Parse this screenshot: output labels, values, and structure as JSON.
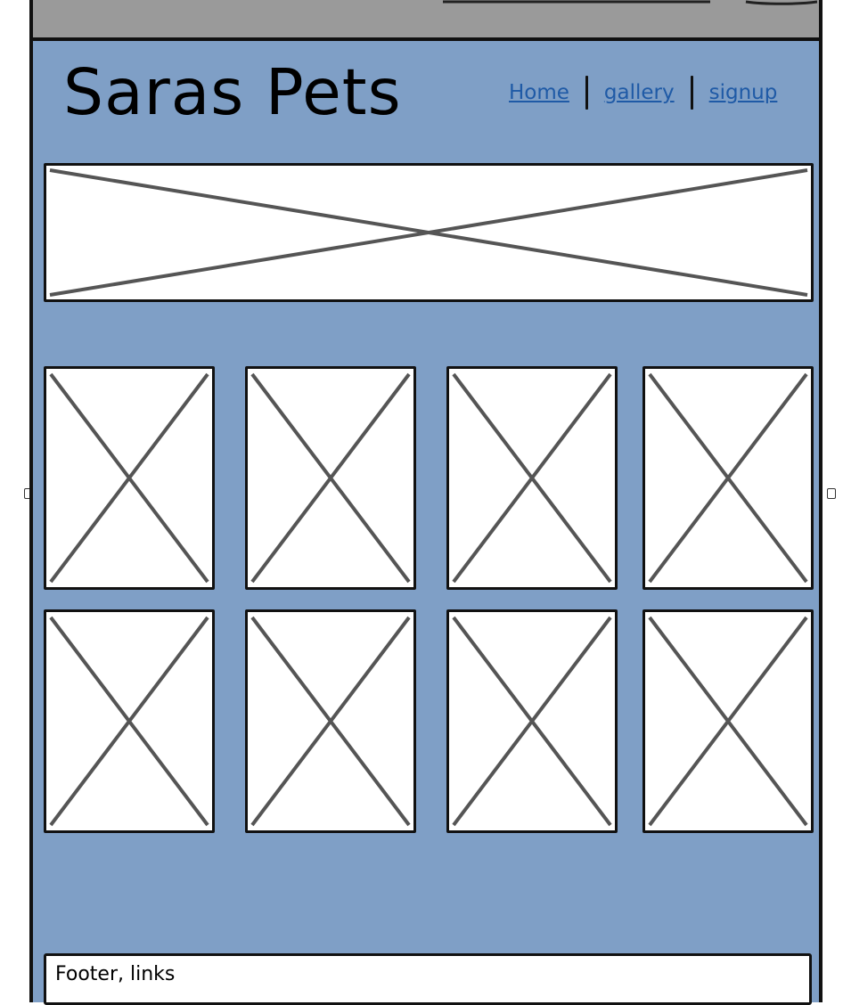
{
  "header": {
    "title": "Saras Pets",
    "nav": {
      "home": "Home",
      "gallery": "gallery",
      "signup": "signup"
    }
  },
  "footer": {
    "text": "Footer, links"
  },
  "colors": {
    "page_background": "#7f9fc6",
    "top_bar": "#9a9a9a",
    "placeholder_fill": "#ffffff",
    "placeholder_cross": "#555555",
    "link": "#1f5aa6"
  },
  "icons": {
    "banner": "image-placeholder-icon",
    "gallery_item": "image-placeholder-icon"
  }
}
